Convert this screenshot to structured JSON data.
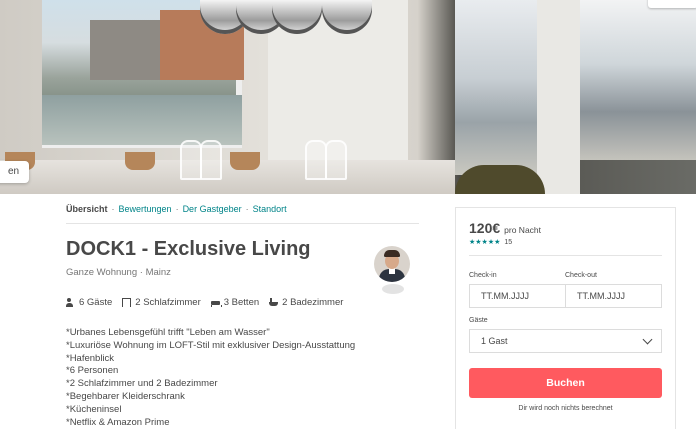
{
  "hero": {
    "badge_left": "en"
  },
  "subnav": {
    "items": [
      "Übersicht",
      "Bewertungen",
      "Der Gastgeber",
      "Standort"
    ],
    "separator": "·"
  },
  "listing": {
    "title": "DOCK1 - Exclusive Living",
    "subtitle": "Ganze Wohnung · Mainz",
    "amenities": [
      {
        "icon": "guests-icon",
        "label": "6 Gäste"
      },
      {
        "icon": "bedroom-icon",
        "label": "2 Schlafzimmer"
      },
      {
        "icon": "bed-icon",
        "label": "3 Betten"
      },
      {
        "icon": "bathroom-icon",
        "label": "2 Badezimmer"
      }
    ],
    "description": [
      "*Urbanes Lebensgefühl trifft \"Leben am Wasser\"",
      "*Luxuriöse Wohnung im LOFT-Stil mit exklusiver Design-Ausstattung",
      "*Hafenblick",
      "*6 Personen",
      "*2 Schlafzimmer und 2 Badezimmer",
      "*Begehbarer Kleiderschrank",
      "*Kücheninsel",
      "*Netflix & Amazon Prime"
    ]
  },
  "booking": {
    "price": "120€",
    "per_night": "pro Nacht",
    "stars": "★★★★★",
    "review_count": "15",
    "checkin_label": "Check-in",
    "checkout_label": "Check-out",
    "checkin_placeholder": "TT.MM.JJJJ",
    "checkout_placeholder": "TT.MM.JJJJ",
    "guests_label": "Gäste",
    "guests_value": "1 Gast",
    "book_label": "Buchen",
    "note": "Dir wird noch nichts berechnet"
  },
  "colors": {
    "accent": "#008489",
    "brand": "#ff5a5f",
    "text": "#484848",
    "muted": "#767676"
  }
}
